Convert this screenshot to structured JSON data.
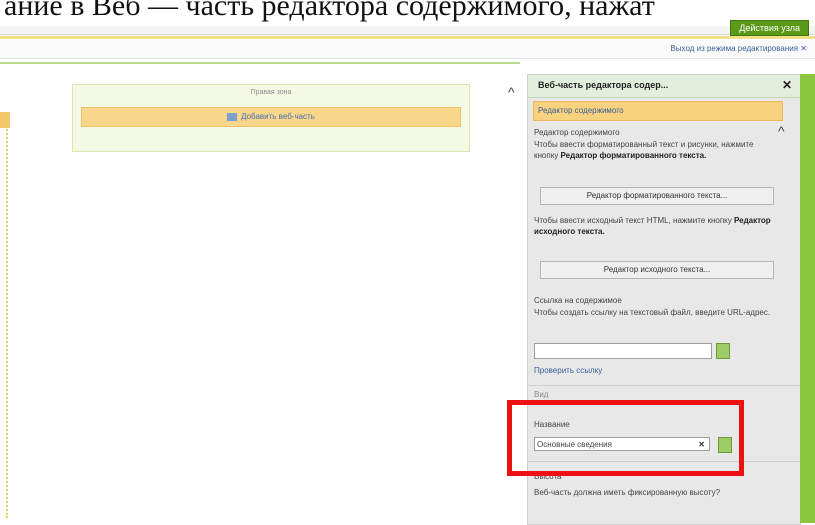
{
  "caption": "ание в Веб — часть редактора содержимого, нажат",
  "top": {
    "site_actions": "Действия узла",
    "exit_edit": "Выход из режима редактирования ✕"
  },
  "zone": {
    "title": "Правая зона",
    "add_webpart": "Добавить веб-часть"
  },
  "panel": {
    "title": "Веб-часть редактора содер...",
    "close": "✕",
    "section_header": "Редактор содержимого",
    "group_label": "Редактор содержимого",
    "rich_text_intro": "Чтобы ввести форматированный текст и рисунки, нажмите кнопку",
    "rich_text_bold": "Редактор форматированного текста.",
    "rich_text_button": "Редактор форматированного текста...",
    "source_intro": "Чтобы ввести исходный текст HTML, нажмите кнопку",
    "source_bold": "Редактор исходного текста.",
    "source_button": "Редактор исходного текста...",
    "link_label": "Ссылка на содержимое",
    "link_intro": "Чтобы создать ссылку на текстовый файл, введите URL-адрес.",
    "url_value": "",
    "check_link": "Проверить ссылку",
    "view_section": "Вид",
    "title_label": "Название",
    "title_value": "Основные сведения",
    "clear": "✕",
    "height_label": "Высота",
    "height_question": "Веб-часть должна иметь фиксированную высоту?"
  },
  "colors": {
    "highlight": "#ee1111",
    "panel_accent": "#8cc63f",
    "header_orange": "#f8d27f"
  }
}
